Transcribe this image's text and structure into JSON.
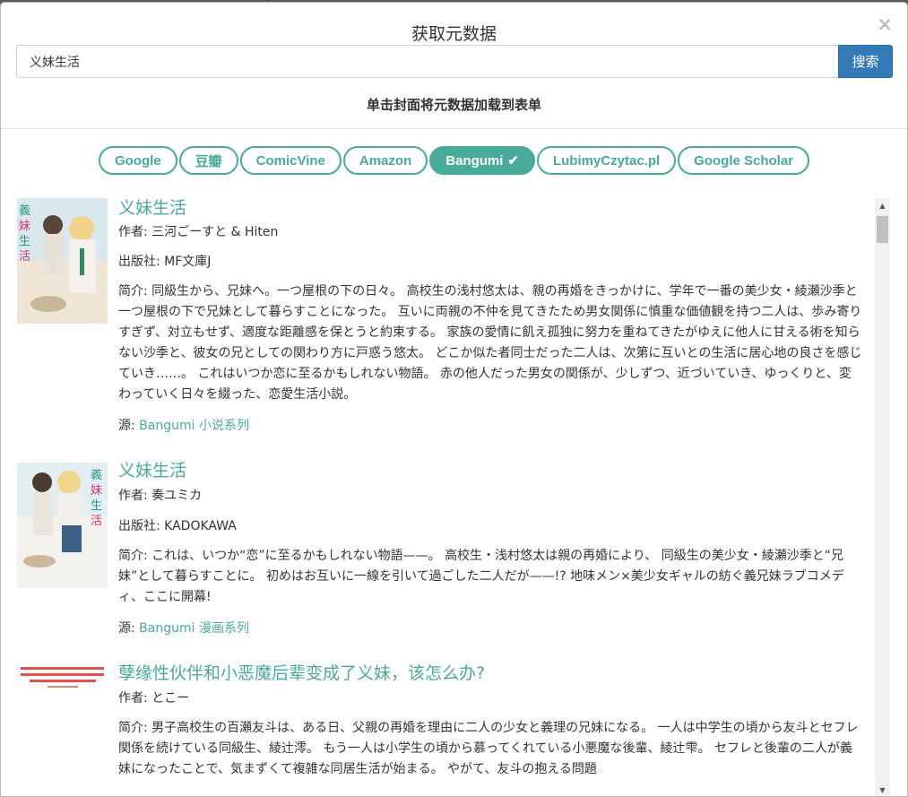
{
  "modal": {
    "title": "获取元数据",
    "close": "×",
    "search_value": "义妹生活",
    "search_button": "搜索",
    "hint": "单击封面将元数据加载到表单"
  },
  "sources": [
    {
      "label": "Google",
      "active": false
    },
    {
      "label": "豆瓣",
      "active": false
    },
    {
      "label": "ComicVine",
      "active": false
    },
    {
      "label": "Amazon",
      "active": false
    },
    {
      "label": "Bangumi",
      "active": true
    },
    {
      "label": "LubimyCzytac.pl",
      "active": false
    },
    {
      "label": "Google Scholar",
      "active": false
    }
  ],
  "results": [
    {
      "title": "义妹生活",
      "author_label": "作者:",
      "author": "三河ごーすと & Hiten",
      "publisher_label": "出版社:",
      "publisher": "MF文庫J",
      "desc_label": "简介:",
      "desc": "同級生から、兄妹へ。一つ屋根の下の日々。 高校生の浅村悠太は、親の再婚をきっかけに、学年で一番の美少女・綾瀬沙季と一つ屋根の下で兄妹として暮らすことになった。 互いに両親の不仲を見てきたため男女関係に慎重な価値観を持つ二人は、歩み寄りすぎず、対立もせず、適度な距離感を保とうと約束する。 家族の愛情に飢え孤独に努力を重ねてきたがゆえに他人に甘える術を知らない沙季と、彼女の兄としての関わり方に戸惑う悠太。 どこか似た者同士だった二人は、次第に互いとの生活に居心地の良さを感じていき……。 これはいつか恋に至るかもしれない物語。 赤の他人だった男女の関係が、少しずつ、近づいていき、ゆっくりと、変わっていく日々を綴った、恋愛生活小説。",
      "source_label": "源:",
      "source": "Bangumi 小说系列"
    },
    {
      "title": "义妹生活",
      "author_label": "作者:",
      "author": "奏ユミカ",
      "publisher_label": "出版社:",
      "publisher": "KADOKAWA",
      "desc_label": "简介:",
      "desc": "これは、いつか“恋”に至るかもしれない物語——。 高校生・浅村悠太は親の再婚により、 同級生の美少女・綾瀬沙季と“兄妹”として暮らすことに。 初めはお互いに一線を引いて過ごした二人だが——!? 地味メン×美少女ギャルの紡ぐ義兄妹ラブコメディ、ここに開幕!",
      "source_label": "源:",
      "source": "Bangumi 漫画系列"
    },
    {
      "title": "孽缘性伙伴和小恶魔后辈变成了义妹，该怎么办?",
      "author_label": "作者:",
      "author": "とこー",
      "desc_label": "简介:",
      "desc": "男子高校生の百瀬友斗は、ある日、父親の再婚を理由に二人の少女と義理の兄妹になる。 一人は中学生の頃から友斗とセフレ関係を続けている同級生、綾辻澪。 もう一人は小学生の頃から慕ってくれている小悪魔な後輩、綾辻雫。 セフレと後輩の二人が義妹になったことで、気まずくて複雑な同居生活が始まる。 やがて、友斗の抱える問題"
    }
  ]
}
